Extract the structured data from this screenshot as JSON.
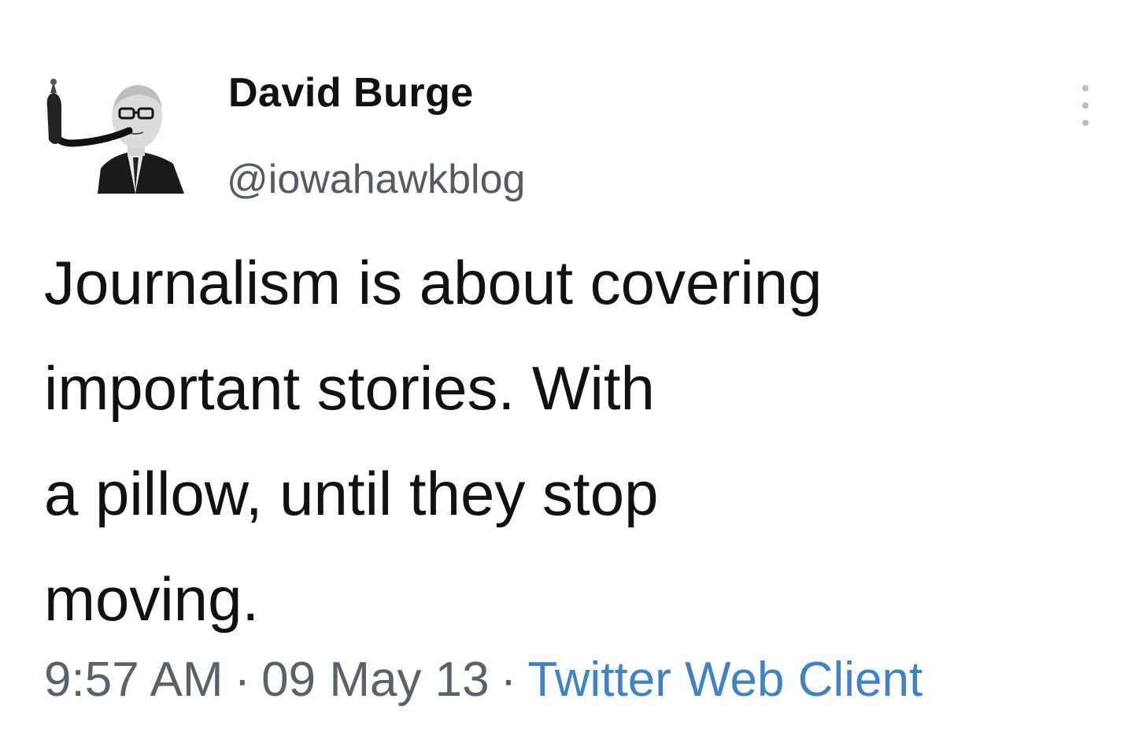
{
  "author": {
    "display_name": "David Burge",
    "handle": "@iowahawkblog",
    "avatar_icon": "avatar-man-with-pipe-icon"
  },
  "tweet": {
    "lines": [
      "Journalism is about covering",
      "important stories. With",
      "a pillow, until they stop",
      "moving."
    ]
  },
  "meta": {
    "time": "9:57 AM",
    "date": "09 May 13",
    "separator": "·",
    "client": "Twitter Web Client"
  },
  "menu": {
    "icon": "more-vertical-icon"
  },
  "colors": {
    "text": "#111111",
    "muted": "#5b6168",
    "link": "#3f83c2",
    "background": "#ffffff"
  }
}
